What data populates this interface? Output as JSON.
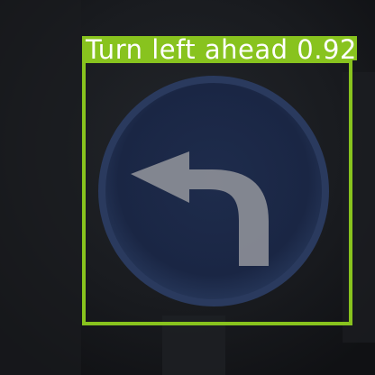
{
  "detection": {
    "label": "Turn left ahead 0.92",
    "class_name": "Turn left ahead",
    "confidence": 0.92,
    "box_color": "#88c31e",
    "label_text_color": "#ffffff"
  },
  "scene": {
    "object": "traffic-sign-turn-left-ahead",
    "sign_color": "#1b2a4a",
    "arrow_color": "#9a9aa0",
    "background_color": "#15171a"
  }
}
